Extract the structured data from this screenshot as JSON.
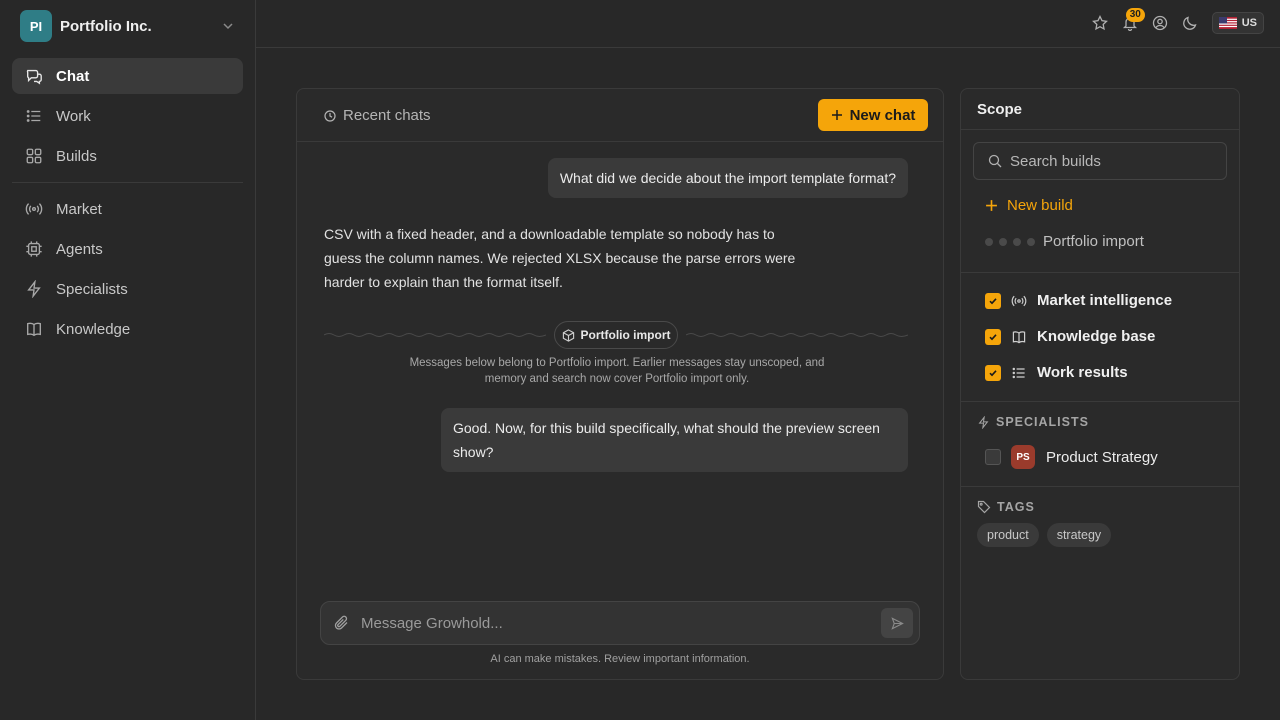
{
  "org": {
    "initials": "PI",
    "name": "Portfolio Inc."
  },
  "nav": {
    "primary": [
      {
        "label": "Chat",
        "icon": "chat-bubbles-icon",
        "active": true
      },
      {
        "label": "Work",
        "icon": "list-icon"
      },
      {
        "label": "Builds",
        "icon": "grid-icon"
      }
    ],
    "secondary": [
      {
        "label": "Market",
        "icon": "broadcast-icon"
      },
      {
        "label": "Agents",
        "icon": "chip-icon"
      },
      {
        "label": "Specialists",
        "icon": "bolt-icon"
      },
      {
        "label": "Knowledge",
        "icon": "book-icon"
      }
    ]
  },
  "topbar": {
    "notification_count": "30",
    "locale": "US"
  },
  "chat": {
    "recent_label": "Recent chats",
    "new_chat_label": "New chat",
    "messages": [
      {
        "role": "user",
        "text": "What did we decide about the import template format?"
      },
      {
        "role": "assistant",
        "text": "CSV with a fixed header, and a downloadable template so nobody has to guess the column names. We rejected XLSX because the parse errors were harder to explain than the format itself."
      },
      {
        "role": "user",
        "text": "Good. Now, for this build specifically, what should the preview screen show?"
      }
    ],
    "scope_pill": "Portfolio import",
    "scope_note": "Messages below belong to Portfolio import. Earlier messages stay unscoped, and memory and search now cover Portfolio import only.",
    "composer_placeholder": "Message Growhold...",
    "disclaimer": "AI can make mistakes. Review important information."
  },
  "scope": {
    "title": "Scope",
    "search_placeholder": "Search builds",
    "new_build_label": "New build",
    "build": "Portfolio import",
    "sources": [
      {
        "label": "Market intelligence",
        "checked": true,
        "icon": "broadcast-icon"
      },
      {
        "label": "Knowledge base",
        "checked": true,
        "icon": "book-icon"
      },
      {
        "label": "Work results",
        "checked": true,
        "icon": "list-icon"
      }
    ],
    "specialists_label": "SPECIALISTS",
    "specialist": {
      "initials": "PS",
      "name": "Product Strategy",
      "checked": false
    },
    "tags_label": "TAGS",
    "tags": [
      "product",
      "strategy"
    ]
  },
  "colors": {
    "accent": "#f5a50a",
    "background": "#282828",
    "org_avatar": "#2f7d86",
    "specialist_avatar": "#9a3b2c"
  }
}
